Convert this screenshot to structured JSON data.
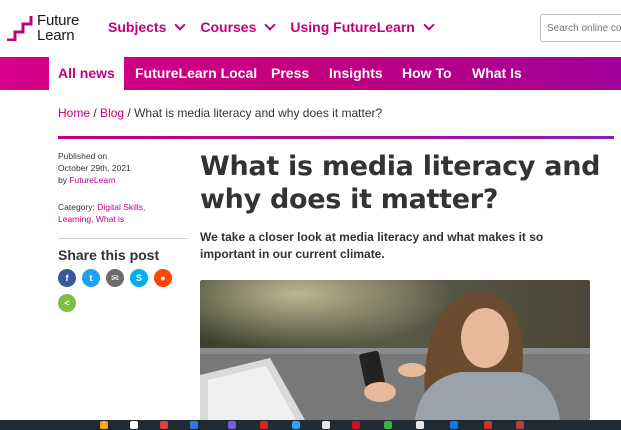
{
  "header": {
    "logo_line1": "Future",
    "logo_line2": "Learn",
    "nav": [
      {
        "label": "Subjects"
      },
      {
        "label": "Courses"
      },
      {
        "label": "Using FutureLearn"
      }
    ],
    "search_placeholder": "Search online co"
  },
  "subnav": {
    "tabs": [
      {
        "label": "All news",
        "active": true
      },
      {
        "label": "FutureLearn Local"
      },
      {
        "label": "Press"
      },
      {
        "label": "Insights"
      },
      {
        "label": "How To"
      },
      {
        "label": "What Is"
      }
    ]
  },
  "breadcrumb": {
    "home": "Home",
    "sep1": " / ",
    "blog": "Blog",
    "sep2": " / ",
    "current": "What is media literacy and why does it matter?"
  },
  "meta": {
    "published_label": "Published on",
    "date": "October 29th, 2021",
    "by_label": "by ",
    "author": "FutureLearn",
    "category_label": "Category: ",
    "cat1": "Digital Skills,",
    "cat2": "Learning,",
    "cat3": "What is"
  },
  "share": {
    "title": "Share this post",
    "buttons": [
      {
        "icon": "facebook-icon",
        "glyph": "f",
        "color": "#3b5998"
      },
      {
        "icon": "twitter-icon",
        "glyph": "t",
        "color": "#1da1f2"
      },
      {
        "icon": "email-icon",
        "glyph": "✉",
        "color": "#6d6d6d"
      },
      {
        "icon": "skype-icon",
        "glyph": "S",
        "color": "#00aff0"
      },
      {
        "icon": "reddit-icon",
        "glyph": "●",
        "color": "#ff4500"
      },
      {
        "icon": "share-icon",
        "glyph": "<",
        "color": "#7ac142"
      }
    ]
  },
  "article": {
    "title": "What is media literacy and why does it matter?",
    "lede": "We take a closer look at media literacy and what makes it so important in our current climate."
  }
}
